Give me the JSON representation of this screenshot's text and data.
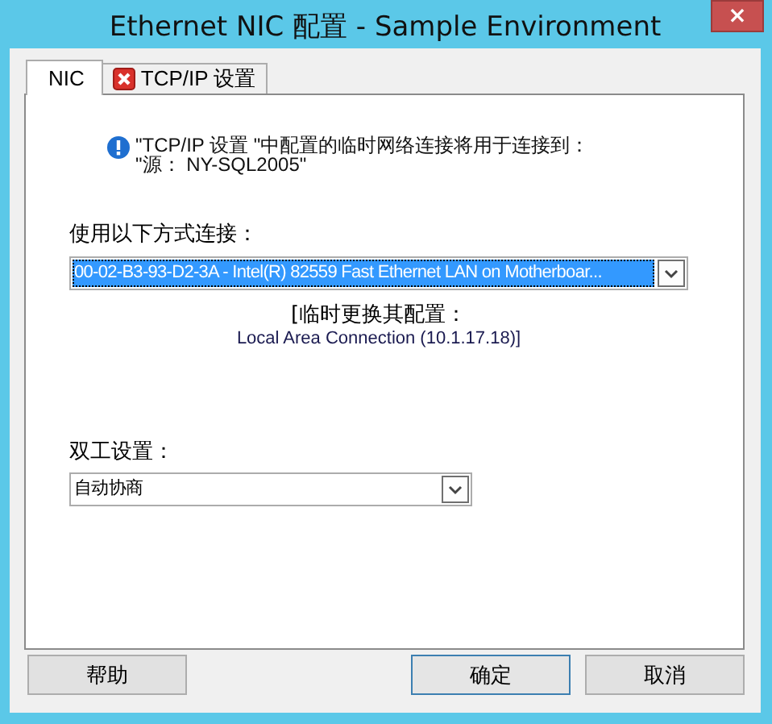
{
  "window": {
    "title": "Ethernet NIC 配置 - Sample Environment",
    "close": "×"
  },
  "tabs": [
    {
      "label": "NIC",
      "selected": true,
      "kind": "plain"
    },
    {
      "label": "TCP/IP 设置",
      "selected": false,
      "kind": "error"
    }
  ],
  "notice": {
    "lines": [
      "\"TCP/IP 设置 \"中配置的临时网络连接将用于连接到：",
      "\"源： NY-SQL2005\""
    ]
  },
  "connection": {
    "label": "使用以下方式连接：",
    "value": "00-02-B3-93-D2-3A - Intel(R) 82559 Fast Ethernet LAN on Motherboar...",
    "focused": true
  },
  "replace": {
    "label": "[临时更换其配置：",
    "value": "Local Area Connection (10.1.17.18)]"
  },
  "duplex": {
    "label": "双工设置：",
    "value": "自动协商",
    "focused": false
  },
  "buttons": [
    {
      "label": "帮助",
      "default": false
    },
    {
      "label": "确定",
      "default": true
    },
    {
      "label": "取消",
      "default": false
    }
  ]
}
